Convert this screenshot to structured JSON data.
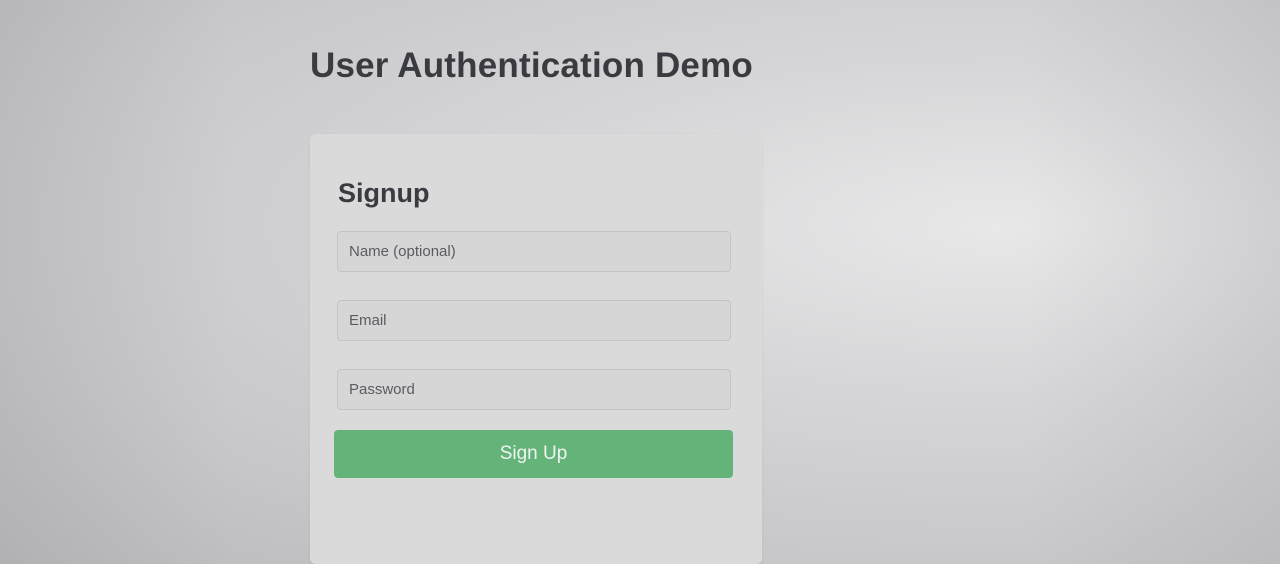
{
  "page": {
    "title": "User Authentication Demo"
  },
  "signup_form": {
    "heading": "Signup",
    "name_field": {
      "placeholder": "Name (optional)",
      "value": ""
    },
    "email_field": {
      "placeholder": "Email",
      "value": ""
    },
    "password_field": {
      "placeholder": "Password",
      "value": ""
    },
    "submit_label": "Sign Up"
  },
  "colors": {
    "accent_button": "#64b47a",
    "text_primary": "#3a3b40",
    "card_background": "#dadadb"
  }
}
